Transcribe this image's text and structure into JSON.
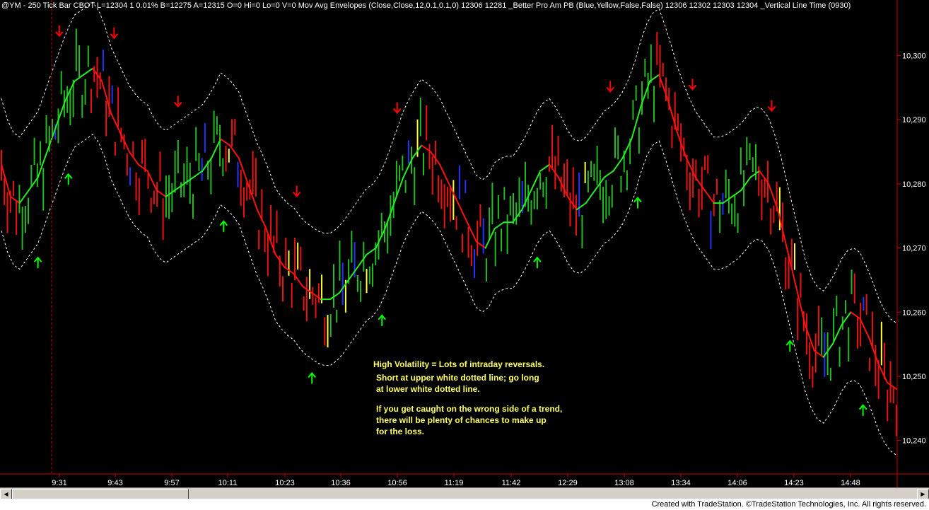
{
  "header": {
    "title": "@YM - 250 Tick Bar  CBOT  L=12304  1  0.01%  B=12275  A=12315  O=0  Hi=0  Lo=0  V=0  Mov Avg Envelopes (Close,Close,12,0.1,0.1,0)   12306  12281   _Better Pro Am PB (Blue,Yellow,False,False)   12306  12302  12303  12304   _Vertical Line Time (0930)"
  },
  "annotations": {
    "line1": "High Volatility = Lots of intraday reversals.",
    "line2": "Short at upper white dotted line; go long\nat lower white dotted line.",
    "line3": "If you get caught on the wrong side of a trend,\nthere will be plenty of chances to make up\nfor the loss."
  },
  "footer": {
    "credit": "Created with TradeStation. ©TradeStation Technologies, Inc. All rights reserved."
  },
  "chart_data": {
    "type": "line",
    "x_ticks": [
      "9:31",
      "9:43",
      "9:57",
      "10:11",
      "10:23",
      "10:36",
      "10:56",
      "11:19",
      "11:42",
      "12:29",
      "13:08",
      "13:34",
      "14:06",
      "14:23",
      "14:48"
    ],
    "y_ticks": [
      "10,300",
      "10,290",
      "10,280",
      "10,270",
      "10,260",
      "10,250",
      "10,240"
    ],
    "ylim": [
      10235,
      10307
    ],
    "bar_count": 150,
    "vertical_line_index": 16,
    "moving_average": [
      [
        0,
        10283
      ],
      [
        3,
        10278
      ],
      [
        6,
        10277
      ],
      [
        9,
        10279
      ],
      [
        12,
        10281
      ],
      [
        15,
        10285
      ],
      [
        18,
        10289
      ],
      [
        21,
        10293
      ],
      [
        24,
        10296
      ],
      [
        27,
        10297
      ],
      [
        30,
        10298
      ],
      [
        33,
        10296
      ],
      [
        36,
        10291
      ],
      [
        39,
        10288
      ],
      [
        42,
        10285
      ],
      [
        45,
        10283
      ],
      [
        48,
        10282
      ],
      [
        51,
        10279
      ],
      [
        54,
        10278
      ],
      [
        57,
        10279
      ],
      [
        60,
        10280
      ],
      [
        63,
        10281
      ],
      [
        66,
        10282
      ],
      [
        69,
        10284
      ],
      [
        72,
        10287
      ],
      [
        75,
        10286
      ],
      [
        78,
        10284
      ],
      [
        81,
        10280
      ],
      [
        84,
        10276
      ],
      [
        87,
        10273
      ],
      [
        90,
        10269
      ],
      [
        93,
        10267
      ],
      [
        96,
        10266
      ],
      [
        99,
        10264
      ],
      [
        102,
        10263
      ],
      [
        105,
        10262
      ],
      [
        108,
        10262
      ],
      [
        111,
        10263
      ],
      [
        114,
        10265
      ],
      [
        117,
        10267
      ],
      [
        120,
        10269
      ],
      [
        123,
        10270
      ],
      [
        126,
        10273
      ],
      [
        129,
        10277
      ],
      [
        132,
        10281
      ],
      [
        135,
        10284
      ],
      [
        138,
        10286
      ],
      [
        141,
        10285
      ],
      [
        144,
        10283
      ],
      [
        147,
        10280
      ],
      [
        150,
        10277
      ],
      [
        153,
        10274
      ],
      [
        156,
        10271
      ],
      [
        159,
        10270
      ],
      [
        162,
        10273
      ],
      [
        165,
        10274
      ],
      [
        168,
        10274
      ],
      [
        171,
        10276
      ],
      [
        174,
        10279
      ],
      [
        177,
        10282
      ],
      [
        180,
        10283
      ],
      [
        183,
        10281
      ],
      [
        186,
        10278
      ],
      [
        189,
        10276
      ],
      [
        192,
        10277
      ],
      [
        195,
        10279
      ],
      [
        198,
        10281
      ],
      [
        201,
        10282
      ],
      [
        204,
        10284
      ],
      [
        207,
        10287
      ],
      [
        210,
        10292
      ],
      [
        213,
        10296
      ],
      [
        216,
        10297
      ],
      [
        219,
        10293
      ],
      [
        222,
        10288
      ],
      [
        225,
        10284
      ],
      [
        228,
        10281
      ],
      [
        231,
        10279
      ],
      [
        234,
        10277
      ],
      [
        237,
        10277
      ],
      [
        240,
        10278
      ],
      [
        243,
        10279
      ],
      [
        246,
        10281
      ],
      [
        249,
        10282
      ],
      [
        252,
        10280
      ],
      [
        255,
        10276
      ],
      [
        258,
        10270
      ],
      [
        261,
        10264
      ],
      [
        264,
        10258
      ],
      [
        267,
        10254
      ],
      [
        270,
        10253
      ],
      [
        273,
        10255
      ],
      [
        276,
        10258
      ],
      [
        279,
        10260
      ],
      [
        282,
        10259
      ],
      [
        285,
        10256
      ],
      [
        288,
        10252
      ],
      [
        291,
        10249
      ],
      [
        294,
        10248
      ]
    ],
    "up_arrows_index": [
      12,
      22,
      73,
      102,
      125,
      176,
      209,
      259,
      283
    ],
    "down_arrows_index": [
      19,
      37,
      58,
      97,
      130,
      200,
      227,
      253
    ],
    "colors": {
      "background": "#000000",
      "ma_up": "#22ee22",
      "ma_down": "#ff1111",
      "envelope": "#ffffff",
      "bar_up": "#22bb22",
      "bar_down": "#ee1111",
      "bar_blue": "#2233ff",
      "bar_yellow": "#ffff33",
      "arrow_up": "#00ff00",
      "arrow_down": "#ff0000",
      "axis_lines": "#cc0000"
    }
  }
}
